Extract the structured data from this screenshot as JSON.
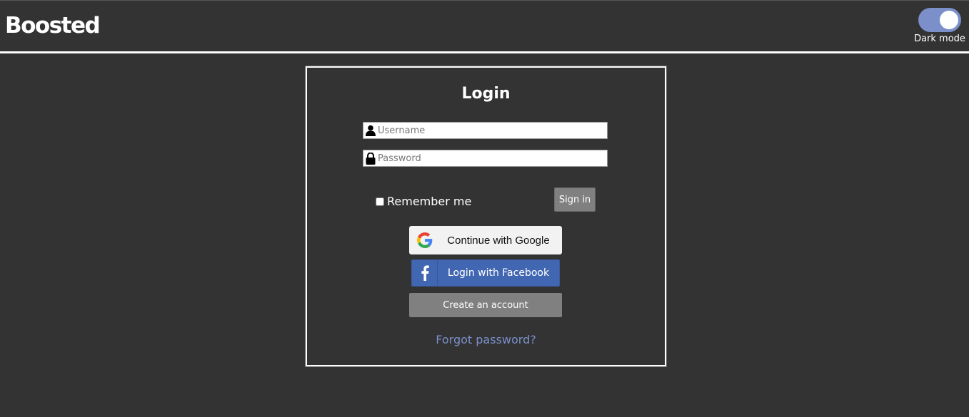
{
  "header": {
    "logo": "Boosted",
    "dark_mode_label": "Dark mode",
    "dark_mode_on": true
  },
  "login": {
    "title": "Login",
    "username_placeholder": "Username",
    "password_placeholder": "Password",
    "remember_label": "Remember me",
    "signin_label": "Sign in",
    "google_label": "Continue with Google",
    "facebook_label": "Login with Facebook",
    "create_label": "Create an account",
    "forgot_label": "Forgot password?"
  },
  "colors": {
    "background": "#333333",
    "accent": "#7b8fca",
    "facebook": "#4267b2",
    "button_gray": "#808080"
  },
  "icons": {
    "username": "user-icon",
    "password": "lock-icon",
    "google": "google-icon",
    "facebook": "facebook-icon"
  }
}
